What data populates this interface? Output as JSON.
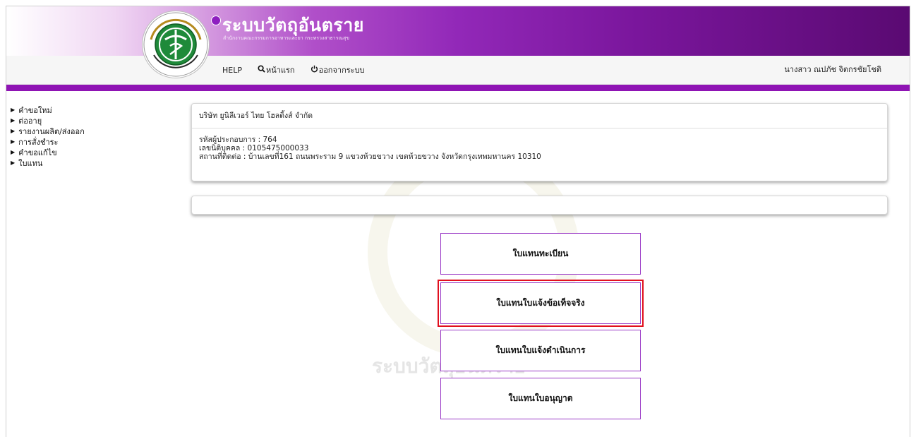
{
  "header": {
    "site_title": "ระบบวัตถุอันตราย",
    "site_subtitle": "สำนักงานคณะกรรมการอาหารและยา กระทรวงสาธารณสุข",
    "logo_text": "กระทรวงสาธารณสุข MINISTRY OF PUBLIC HEALTH"
  },
  "topnav": {
    "help": "HELP",
    "home": "หน้าแรก",
    "logout": "ออกจากระบบ",
    "user_name": "นางสาว ณปภัช จิตกรชัยโชติ"
  },
  "sidebar": {
    "items": [
      {
        "label": "คำขอใหม่"
      },
      {
        "label": "ต่ออายุ"
      },
      {
        "label": "รายงานผลิต/ส่งออก"
      },
      {
        "label": "การสั่งชำระ"
      },
      {
        "label": "คำขอแก้ไข"
      },
      {
        "label": "ใบแทน"
      }
    ]
  },
  "company": {
    "name": "บริษัท ยูนิลีเวอร์ ไทย โฮลดิ้งส์ จำกัด",
    "operator_id": "รหัสผู้ประกอบการ : 764",
    "juristic_id": "เลขนิติบุคคล : 0105475000033",
    "address": "สถานที่ติดต่อ : บ้านเลขที่161 ถนนพระราม 9 แขวงห้วยขวาง เขตห้วยขวาง จังหวัดกรุงเทพมหานคร 10310"
  },
  "watermark": {
    "text": "ระบบวัตถุอันตราย"
  },
  "actions": [
    {
      "label": "ใบแทนทะเบียน",
      "selected": false
    },
    {
      "label": "ใบแทนใบแจ้งข้อเท็จจริง",
      "selected": true
    },
    {
      "label": "ใบแทนใบแจ้งดำเนินการ",
      "selected": false
    },
    {
      "label": "ใบแทนใบอนุญาต",
      "selected": false
    }
  ],
  "colors": {
    "brand_purple": "#8f14b4",
    "selection_red": "#e1101e"
  },
  "icons": {
    "home": "magnifier-icon",
    "logout": "power-icon",
    "sidebar": "triangle-right-icon"
  }
}
